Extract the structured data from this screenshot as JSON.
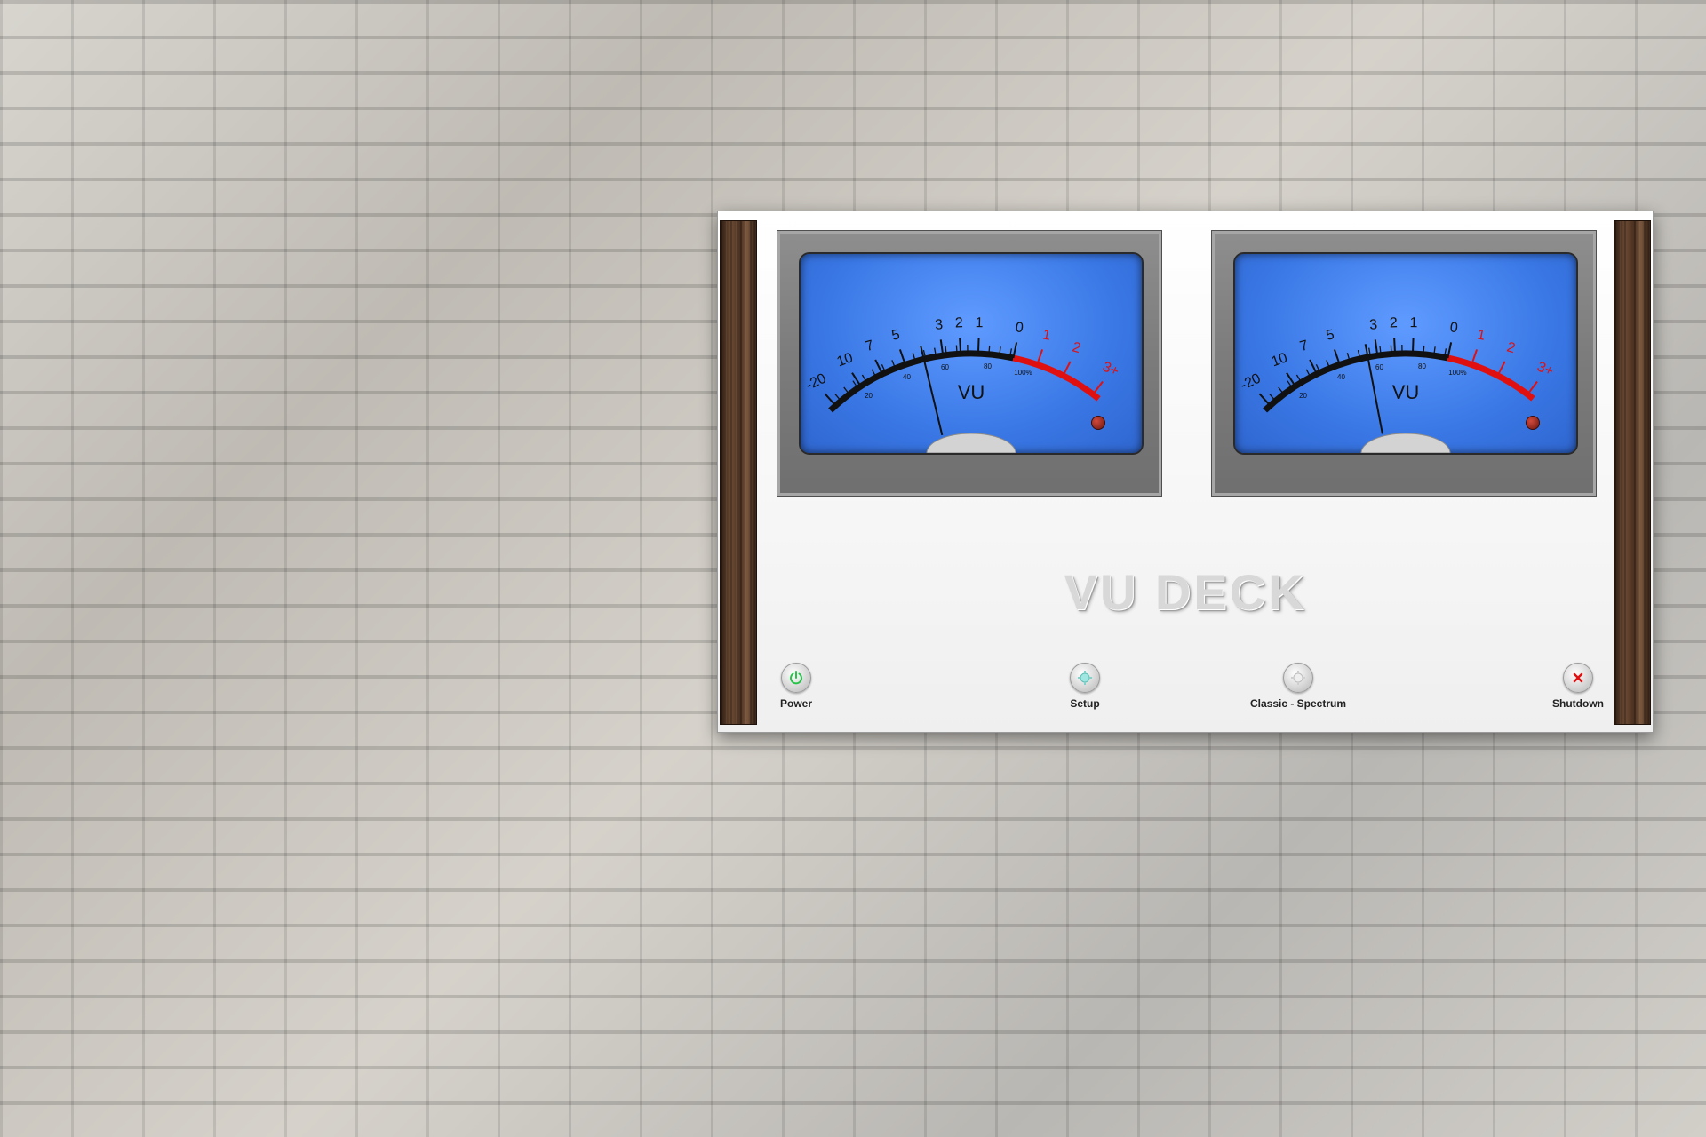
{
  "app": {
    "title": "VU DECK"
  },
  "meters": [
    {
      "id": "left",
      "unit_label": "VU",
      "db_scale": [
        "-20",
        "10",
        "7",
        "5",
        "3",
        "2",
        "1",
        "0",
        "1",
        "2",
        "3+"
      ],
      "percent_scale": [
        "20",
        "40",
        "60",
        "80",
        "100%"
      ],
      "needle_value_db": -4
    },
    {
      "id": "right",
      "unit_label": "VU",
      "db_scale": [
        "-20",
        "10",
        "7",
        "5",
        "3",
        "2",
        "1",
        "0",
        "1",
        "2",
        "3+"
      ],
      "percent_scale": [
        "20",
        "40",
        "60",
        "80",
        "100%"
      ],
      "needle_value_db": -3.5
    }
  ],
  "controls": [
    {
      "name": "power",
      "label": "Power",
      "icon": "power-icon"
    },
    {
      "name": "setup",
      "label": "Setup",
      "icon": "setup-icon"
    },
    {
      "name": "mode",
      "label": "Classic - Spectrum",
      "icon": "mode-icon"
    },
    {
      "name": "shutdown",
      "label": "Shutdown",
      "icon": "close-icon"
    }
  ],
  "colors": {
    "meter_face": "#3a78e6",
    "scale_black": "#111111",
    "scale_red": "#e01010",
    "power_green": "#27c24a",
    "shutdown_red": "#e01010"
  }
}
